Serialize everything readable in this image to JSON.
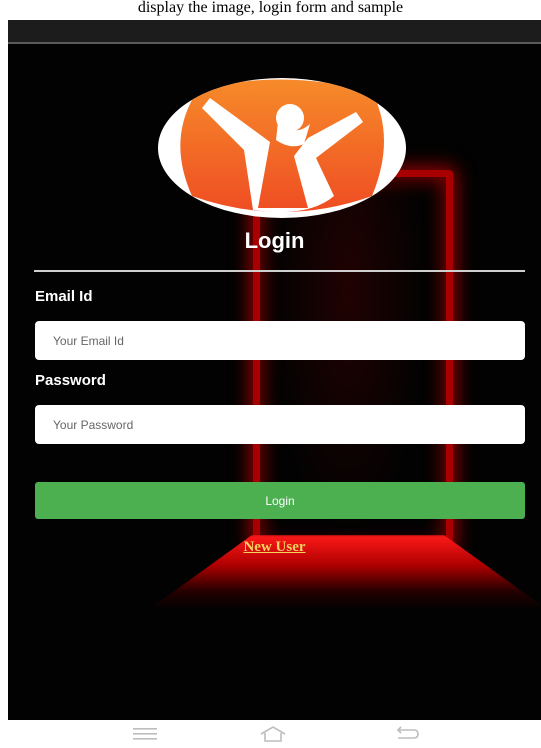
{
  "caption": "display the image, login form and sample",
  "logo": {
    "name": "app-logo",
    "colors": {
      "circle": "#ffffff",
      "figure": "#f26a22"
    }
  },
  "login_title": "Login",
  "email": {
    "label": "Email Id",
    "placeholder": "Your Email Id",
    "value": ""
  },
  "password": {
    "label": "Password",
    "placeholder": "Your Password",
    "value": ""
  },
  "login_button": "Login",
  "new_user_link": "New User",
  "colors": {
    "background": "#020202",
    "button": "#4caf50",
    "link": "#f4d35e",
    "glow": "#ff1a1a"
  },
  "nav": {
    "menu_icon": "menu-icon",
    "home_icon": "home-icon",
    "back_icon": "back-icon"
  }
}
